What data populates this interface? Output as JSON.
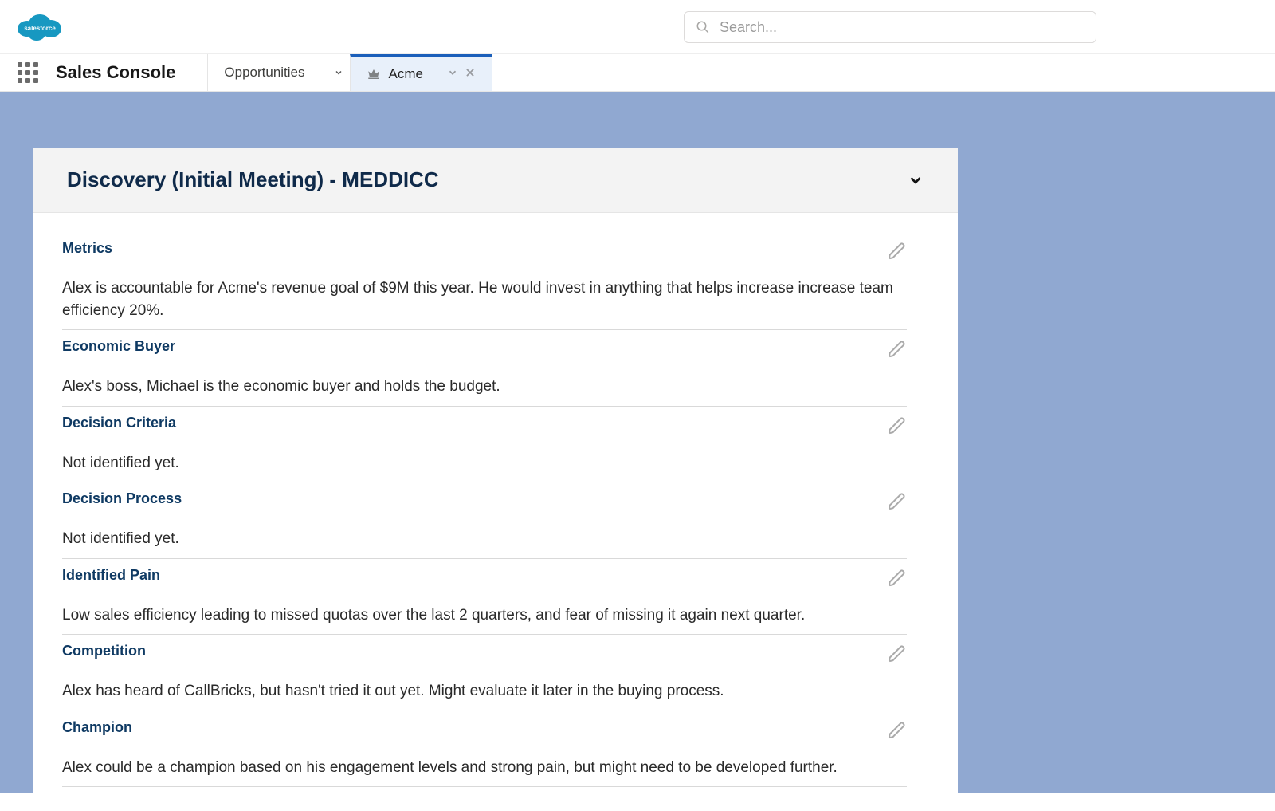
{
  "header": {
    "search_placeholder": "Search..."
  },
  "app": {
    "name": "Sales Console",
    "tabs": [
      {
        "label": "Opportunities",
        "active": false
      },
      {
        "label": "Acme",
        "active": true
      }
    ]
  },
  "card": {
    "title": "Discovery (Initial Meeting) - MEDDICC",
    "fields": [
      {
        "label": "Metrics",
        "value": "Alex is accountable for Acme's revenue goal of $9M this year. He would invest in anything that helps increase increase team efficiency 20%."
      },
      {
        "label": "Economic Buyer",
        "value": "Alex's boss, Michael is the economic buyer and holds the budget."
      },
      {
        "label": "Decision Criteria",
        "value": "Not identified yet."
      },
      {
        "label": "Decision Process",
        "value": "Not identified yet."
      },
      {
        "label": "Identified Pain",
        "value": "Low sales efficiency leading to missed quotas over the last 2 quarters, and fear of missing it again next quarter."
      },
      {
        "label": "Competition",
        "value": "Alex has heard of CallBricks, but hasn't tried it out yet. Might evaluate it later in the buying process."
      },
      {
        "label": "Champion",
        "value": "Alex could be a champion based on his engagement levels and strong pain, but might need to be developed further."
      }
    ]
  }
}
